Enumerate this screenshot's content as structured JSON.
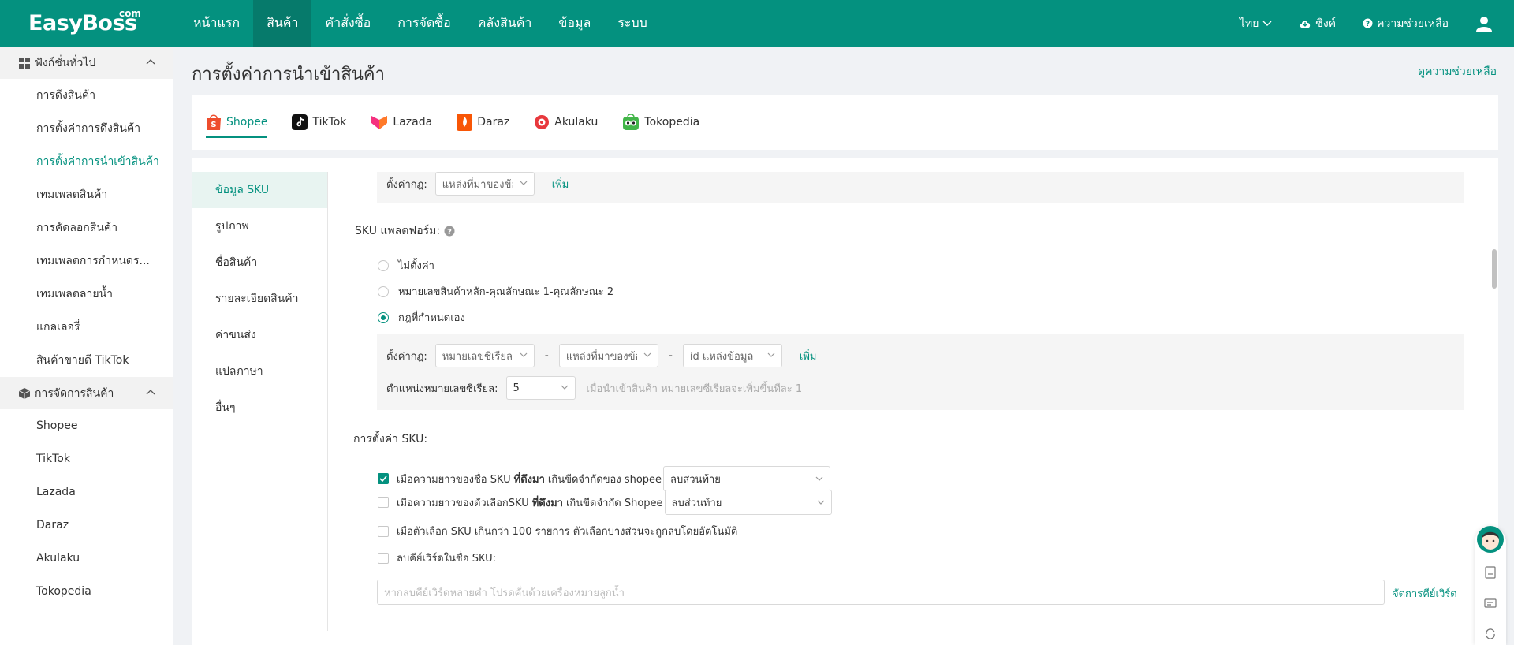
{
  "app": {
    "logo": "EasyBoss",
    "logo_suffix": "com",
    "nav": [
      "หน้าแรก",
      "สินค้า",
      "คำสั่งซื้อ",
      "การจัดซื้อ",
      "คลังสินค้า",
      "ข้อมูล",
      "ระบบ"
    ],
    "language": "ไทย",
    "sync": "ซิงค์",
    "help": "ความช่วยเหลือ"
  },
  "sidebar": {
    "group1": "ฟังก์ชั่นทั่วไป",
    "group1_items": [
      "การดึงสินค้า",
      "การตั้งค่าการดึงสินค้า",
      "การตั้งค่าการนำเข้าสินค้า",
      "เทมเพลตสินค้า",
      "การคัดลอกสินค้า",
      "เทมเพลตการกำหนดร...",
      "เทมเพลตลายน้ำ",
      "แกลเลอรี่",
      "สินค้าขายดี TikTok"
    ],
    "group2": "การจัดการสินค้า",
    "group2_items": [
      "Shopee",
      "TikTok",
      "Lazada",
      "Daraz",
      "Akulaku",
      "Tokopedia"
    ]
  },
  "page": {
    "title": "การตั้งค่าการนำเข้าสินค้า",
    "help_link": "ดูความช่วยเหลือ"
  },
  "platform_tabs": [
    "Shopee",
    "TikTok",
    "Lazada",
    "Daraz",
    "Akulaku",
    "Tokopedia"
  ],
  "sub_nav": [
    "ข้อมูล SKU",
    "รูปภาพ",
    "ชื่อสินค้า",
    "รายละเอียดสินค้า",
    "ค่าขนส่ง",
    "แปลภาษา",
    "อื่นๆ"
  ],
  "top_rule": {
    "label": "ตั้งค่ากฎ:",
    "select": "แหล่งที่มาของข้อมูล",
    "add": "เพิ่ม"
  },
  "platform_sku": {
    "title": "SKU แพลตฟอร์ม:",
    "options": [
      "ไม่ตั้งค่า",
      "หมายเลขสินค้าหลัก-คุณลักษณะ 1-คุณลักษณะ 2",
      "กฎที่กำหนดเอง"
    ],
    "rule_label": "ตั้งค่ากฎ:",
    "rule_selects": [
      "หมายเลขซีเรียล",
      "แหล่งที่มาของข้อมูล",
      "id แหล่งข้อมูล"
    ],
    "dash": "-",
    "add": "เพิ่ม",
    "serial_label": "ตำแหน่งหมายเลขซีเรียล:",
    "serial_value": "5",
    "serial_hint": "เมื่อนำเข้าสินค้า หมายเลขซีเรียลจะเพิ่มขึ้นทีละ 1"
  },
  "sku_settings": {
    "title": "การตั้งค่า SKU:",
    "row1_a": "เมื่อความยาวของชื่อ SKU",
    "row1_b": "ที่ดึงมา",
    "row1_c": "เกินขีดจำกัดของ shopee",
    "row1_select": "ลบส่วนท้าย",
    "row2_a": "เมื่อความยาวของตัวเลือกSKU",
    "row2_b": "ที่ดึงมา",
    "row2_c": "เกินขีดจำกัด Shopee",
    "row2_select": "ลบส่วนท้าย",
    "row3": "เมื่อตัวเลือก SKU เกินกว่า 100 รายการ ตัวเลือกบางส่วนจะถูกลบโดยอัตโนมัติ",
    "row4": "ลบคีย์เวิร์ดในชื่อ SKU:",
    "keyword_placeholder": "หากลบคีย์เวิร์ดหลายคำ  โปรดคั่นด้วยเครื่องหมายลูกน้ำ",
    "manage_keywords": "จัดการคีย์เวิร์ด"
  },
  "colors": {
    "brand": "#04917f",
    "brand_dark": "#067a6b"
  }
}
